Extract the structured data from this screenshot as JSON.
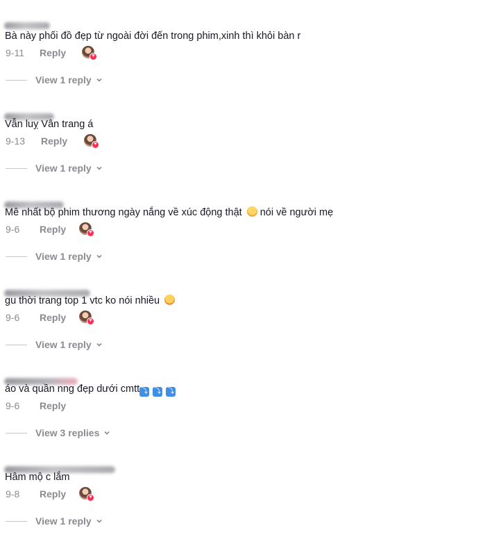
{
  "comments": [
    {
      "text": "Bà này phối đồ đẹp từ ngoài đời đến trong phim,xinh thì khỏi bàn r",
      "date": "9-11",
      "reply_label": "Reply",
      "view_replies": "View 1 reply"
    },
    {
      "text": "Vẫn luỵ Vân trang á",
      "date": "9-13",
      "reply_label": "Reply",
      "view_replies": "View 1 reply"
    },
    {
      "text": "Mê nhất bộ phim thương ngày nắng về xúc động thật",
      "text_after": " nói về người mẹ",
      "date": "9-6",
      "reply_label": "Reply",
      "view_replies": "View 1 reply"
    },
    {
      "text": "gu thời trang top 1 vtc ko nói nhiều",
      "date": "9-6",
      "reply_label": "Reply",
      "view_replies": "View 1 reply"
    },
    {
      "text": "áo và quần nng đẹp dưới cmtt",
      "date": "9-6",
      "reply_label": "Reply",
      "view_replies": "View 3 replies"
    },
    {
      "text": "Hâm mộ c lắm",
      "date": "9-8",
      "reply_label": "Reply",
      "view_replies": "View 1 reply"
    }
  ],
  "icons": {
    "sad_emoji": "disappointed-face-emoji",
    "laugh_emoji": "rolling-laughing-emoji",
    "down_arrow": "right-arrow-curving-down-emoji",
    "chevron": "chevron-down-icon",
    "creator_like": "creator-liked-avatar-icon"
  },
  "colors": {
    "muted": "#8a8b91",
    "text": "#161823",
    "heart": "#fe2c55",
    "keycap": "#3f8fe6"
  }
}
